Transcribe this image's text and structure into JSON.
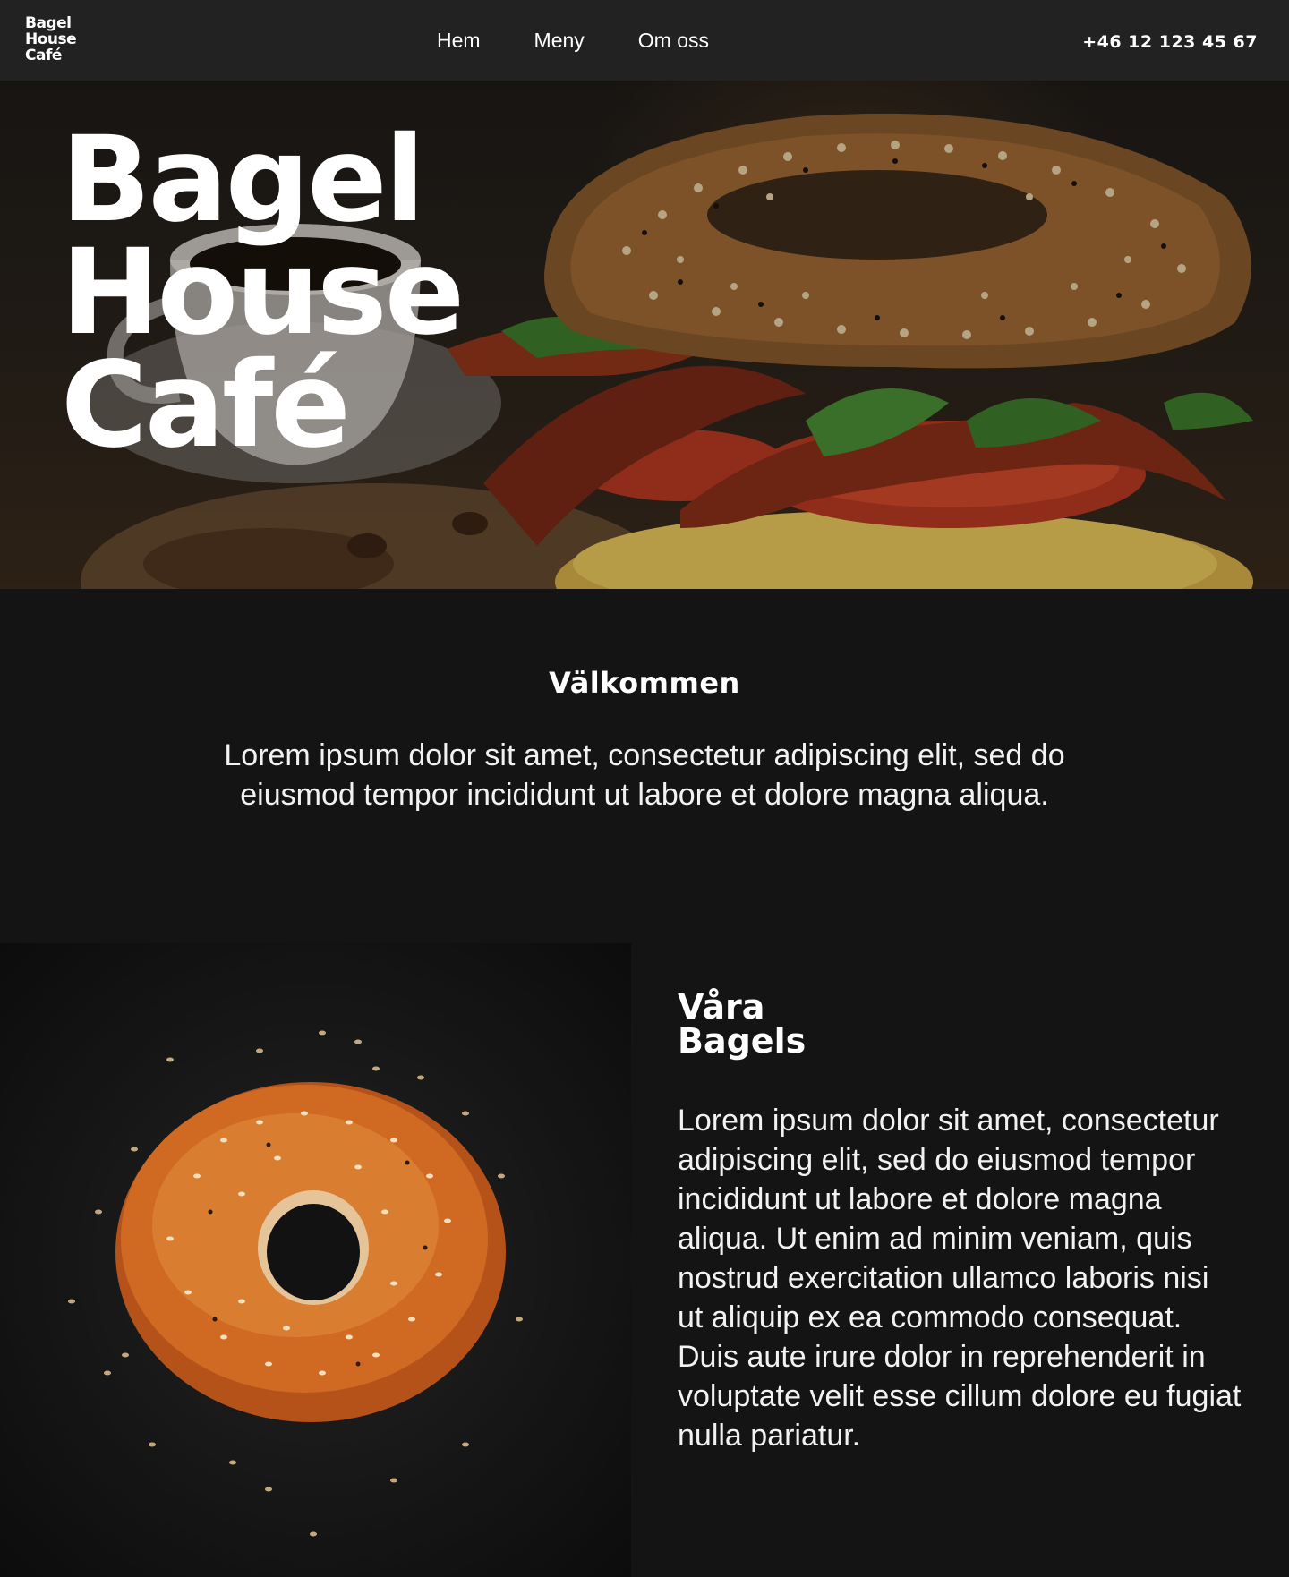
{
  "nav": {
    "logo_lines": [
      "Bagel",
      "House",
      "Café"
    ],
    "links": [
      {
        "label": "Hem"
      },
      {
        "label": "Meny"
      },
      {
        "label": "Om oss"
      }
    ],
    "phone": "+46 12 123 45 67"
  },
  "hero": {
    "title_lines": [
      "Bagel",
      "House",
      "Café"
    ]
  },
  "welcome": {
    "heading": "Välkommen",
    "body": "Lorem ipsum dolor sit amet, consectetur adipiscing elit, sed do eiusmod tempor incididunt ut labore et dolore magna aliqua."
  },
  "bagels": {
    "heading_lines": [
      "Våra",
      "Bagels"
    ],
    "body": "Lorem ipsum dolor sit amet, consectetur adipiscing elit, sed do eiusmod tempor incididunt ut labore et dolore magna aliqua. Ut enim ad minim veniam, quis nostrud exercitation ullamco laboris nisi ut aliquip ex ea commodo consequat. Duis aute irure dolor in reprehenderit in voluptate velit esse cillum dolore eu fugiat nulla pariatur."
  },
  "colors": {
    "page_bg": "#141414",
    "nav_bg": "#222222",
    "text": "#ffffff"
  }
}
